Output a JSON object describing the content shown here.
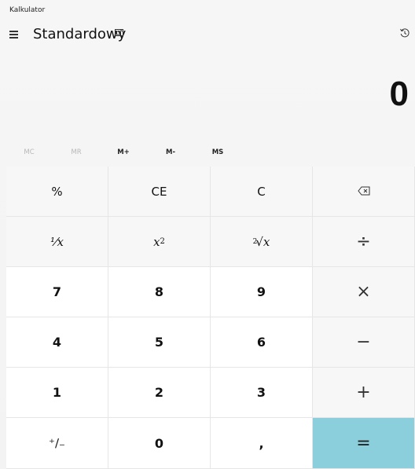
{
  "window": {
    "title": "Kalkulator"
  },
  "header": {
    "mode_title": "Standardowy",
    "menu_icon": "hamburger-icon",
    "keep_on_top_icon": "keep-on-top-icon",
    "history_icon": "history-icon"
  },
  "display": {
    "value": "0"
  },
  "memory": {
    "buttons": [
      {
        "label": "MC",
        "enabled": false
      },
      {
        "label": "MR",
        "enabled": false
      },
      {
        "label": "M+",
        "enabled": true
      },
      {
        "label": "M-",
        "enabled": true
      },
      {
        "label": "MS",
        "enabled": true
      }
    ]
  },
  "keys": {
    "percent": "%",
    "clear_entry": "CE",
    "clear": "C",
    "backspace_icon": "backspace-icon",
    "reciprocal": "¹⁄x",
    "square_base": "x",
    "square_exp": "2",
    "sqrt_index": "2",
    "sqrt_sym": "√x",
    "divide": "÷",
    "n7": "7",
    "n8": "8",
    "n9": "9",
    "multiply": "×",
    "n4": "4",
    "n5": "5",
    "n6": "6",
    "subtract": "−",
    "n1": "1",
    "n2": "2",
    "n3": "3",
    "add": "+",
    "negate": "⁺∕₋",
    "n0": "0",
    "decimal": ",",
    "equals": "="
  },
  "colors": {
    "equals_bg": "#8ccfdc",
    "number_key_bg": "#ffffff",
    "function_key_bg": "#f7f7f7"
  }
}
